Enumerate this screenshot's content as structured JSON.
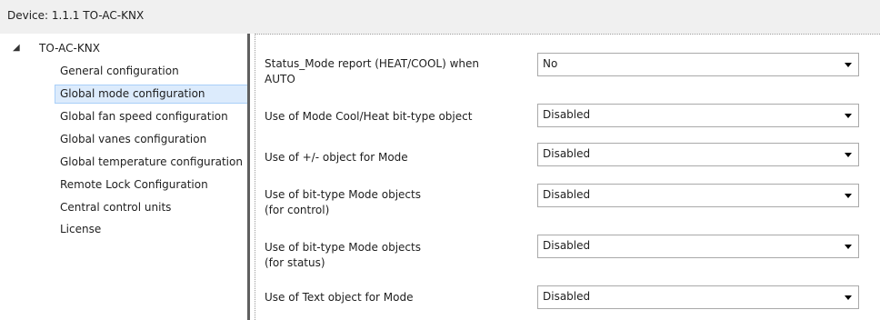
{
  "header": {
    "device_title": "Device: 1.1.1  TO-AC-KNX"
  },
  "tree": {
    "root_label": "TO-AC-KNX",
    "items": [
      {
        "label": "General configuration",
        "selected": false
      },
      {
        "label": "Global mode configuration",
        "selected": true
      },
      {
        "label": "Global fan speed configuration",
        "selected": false
      },
      {
        "label": "Global vanes configuration",
        "selected": false
      },
      {
        "label": "Global temperature configuration",
        "selected": false
      },
      {
        "label": "Remote Lock Configuration",
        "selected": false
      },
      {
        "label": "Central control units",
        "selected": false
      },
      {
        "label": "License",
        "selected": false
      }
    ]
  },
  "parameters": [
    {
      "label": "Status_Mode report (HEAT/COOL) when\nAUTO",
      "value": "No"
    },
    {
      "label": "Use of Mode Cool/Heat bit-type object",
      "value": "Disabled"
    },
    {
      "label": "Use of +/- object for Mode",
      "value": "Disabled"
    },
    {
      "label": "Use of bit-type Mode objects\n(for control)",
      "value": "Disabled"
    },
    {
      "label": "Use of bit-type Mode objects\n(for status)",
      "value": "Disabled"
    },
    {
      "label": "Use of Text object for Mode",
      "value": "Disabled"
    }
  ]
}
